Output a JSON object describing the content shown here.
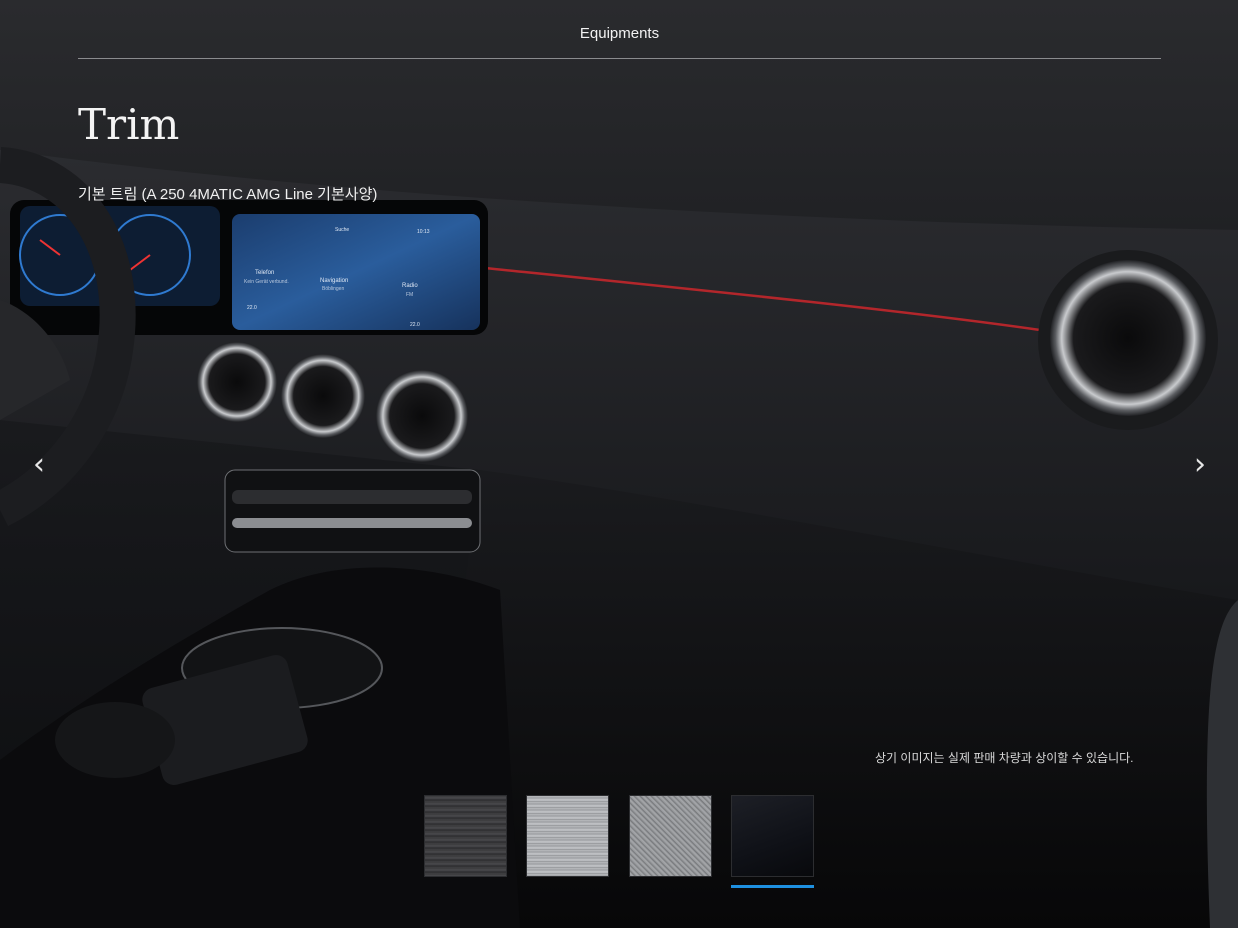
{
  "header": {
    "title": "Equipments"
  },
  "trim": {
    "title": "Trim",
    "subtitle": "기본 트림 (A 250 4MATIC AMG Line 기본사양)"
  },
  "display": {
    "phone_label": "Telefon",
    "phone_sub": "Kein Gerät verbund.",
    "nav_label": "Navigation",
    "nav_sub": "Böblingen",
    "radio_label": "Radio",
    "radio_sub": "FM",
    "search": "Suche",
    "clock": "10:13",
    "temp_left": "22.0",
    "temp_right": "22.0"
  },
  "disclaimer": "상기 이미지는 실제 판매 차량과 상이할 수 있습니다.",
  "swatches": {
    "items": [
      "trim-option-1",
      "trim-option-2",
      "trim-option-3",
      "trim-option-4"
    ],
    "selected_index": 3,
    "accent_color": "#1e90e0"
  },
  "icons": {
    "prev": "‹",
    "next": "›"
  }
}
